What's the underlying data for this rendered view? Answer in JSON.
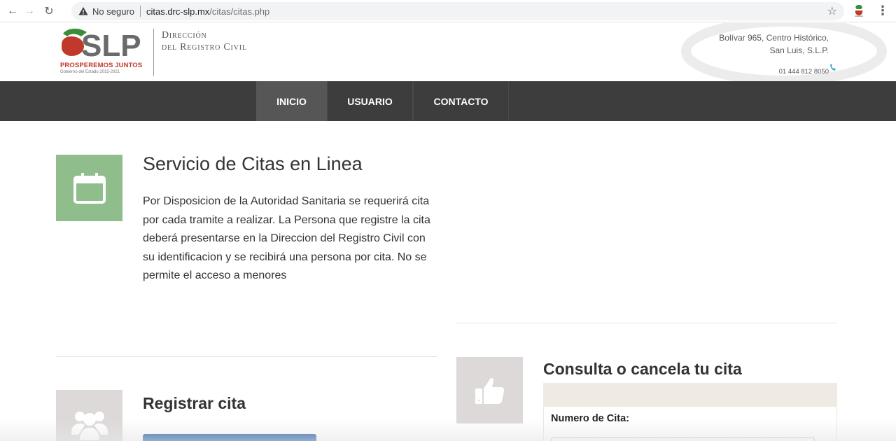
{
  "browser": {
    "insecure_label": "No seguro",
    "url_host": "citas.drc-slp.mx",
    "url_path": "/citas/citas.php",
    "back_icon": "arrow-left-icon",
    "forward_icon": "arrow-right-icon",
    "reload_icon": "reload-icon",
    "bookmark_icon": "star-icon",
    "menu_icon": "kebab-menu-icon"
  },
  "header": {
    "logo_text": "SLP",
    "logo_tagline": "PROSPEREMOS JUNTOS",
    "logo_subtitle": "Gobierno del Estado 2015-2021",
    "department_line1": "Dirección",
    "department_line2": "del Registro Civil",
    "address_line1": "Bolívar 965, Centro Histórico,",
    "address_line2": "San Luis, S.L.P.",
    "phone": "01 444 812 8050"
  },
  "nav": {
    "items": [
      {
        "label": "INICIO",
        "active": true
      },
      {
        "label": "USUARIO",
        "active": false
      },
      {
        "label": "CONTACTO",
        "active": false
      }
    ]
  },
  "service": {
    "title": "Servicio de Citas en Linea",
    "description": "Por Disposicion de la Autoridad Sanitaria se requerirá cita por cada tramite a realizar. La Persona que registre la cita deberá presentarse en la Direccion del Registro Civil con su identificacion y se recibirá una persona por cita. No se permite el acceso a menores",
    "icon": "calendar-icon"
  },
  "consulta": {
    "title": "Consulta o cancela tu cita",
    "numero_label": "Numero de Cita:",
    "icon": "thumbs-up-icon"
  },
  "registrar": {
    "title": "Registrar cita",
    "icon": "users-icon"
  },
  "colors": {
    "navbar": "#3d3d3d",
    "nav_active": "#565656",
    "green_tile": "#8fbd8c",
    "gray_tile": "#dcd9d8",
    "button_blue": "#1f5aa6",
    "logo_red": "#c0392b"
  }
}
